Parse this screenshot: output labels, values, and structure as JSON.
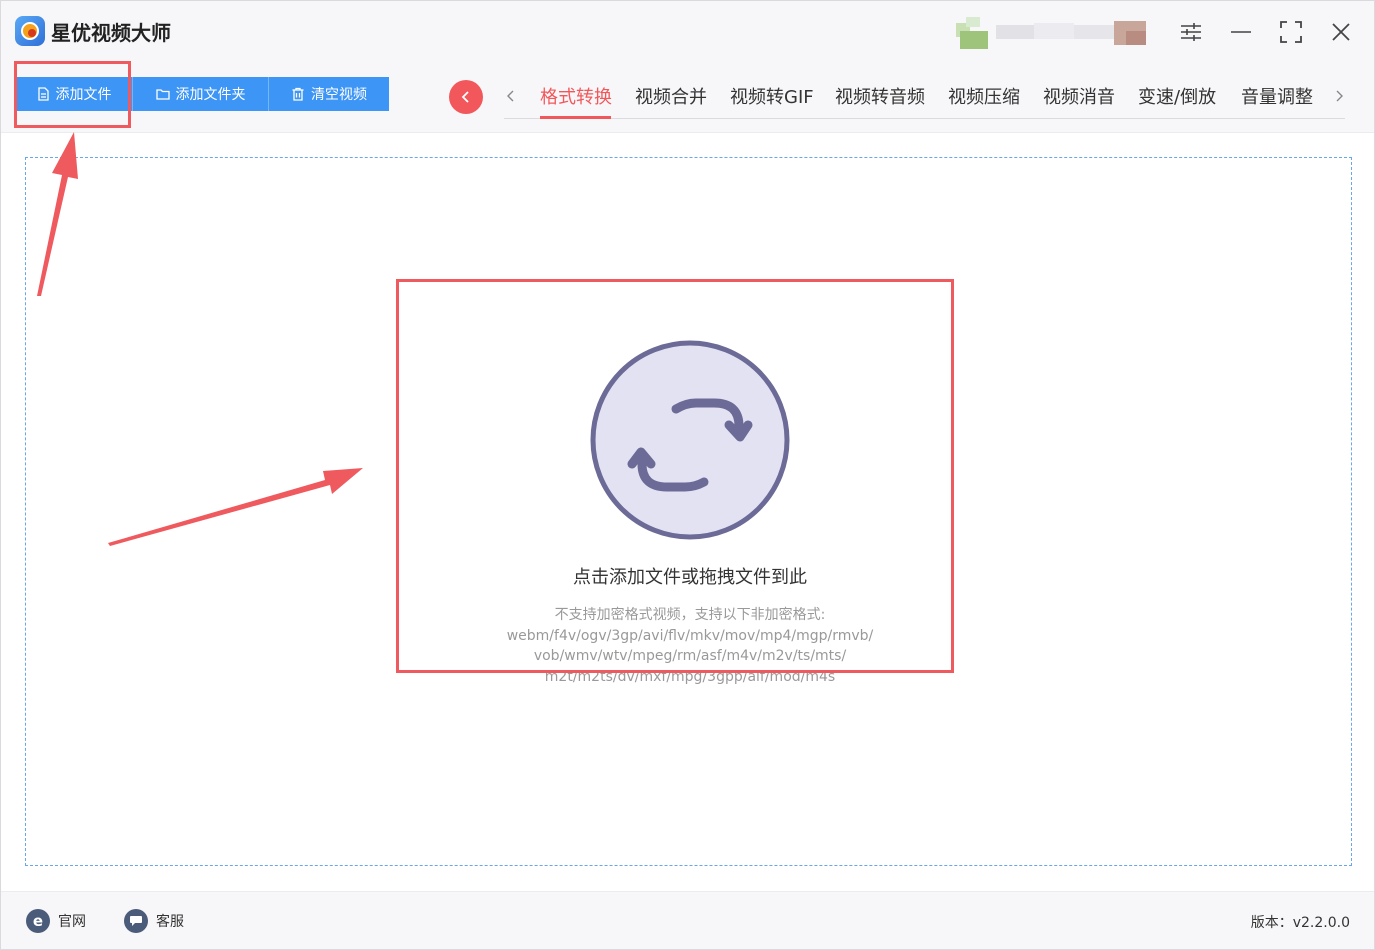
{
  "app": {
    "title": "星优视频大师"
  },
  "window_controls": [
    "settings-icon",
    "minimize-icon",
    "maximize-icon",
    "close-icon"
  ],
  "toolbar": {
    "buttons": [
      {
        "label": "添加文件",
        "icon": "file-icon"
      },
      {
        "label": "添加文件夹",
        "icon": "folder-icon"
      },
      {
        "label": "清空视频",
        "icon": "trash-icon"
      }
    ]
  },
  "tabs": {
    "items": [
      "格式转换",
      "视频合并",
      "视频转GIF",
      "视频转音频",
      "视频压缩",
      "视频消音",
      "变速/倒放",
      "音量调整"
    ],
    "active": "格式转换"
  },
  "dropzone": {
    "title": "点击添加文件或拖拽文件到此",
    "hint_lines": [
      "不支持加密格式视频，支持以下非加密格式:",
      "webm/f4v/ogv/3gp/avi/flv/mkv/mov/mp4/mgp/rmvb/",
      "vob/wmv/wtv/mpeg/rm/asf/m4v/m2v/ts/mts/",
      "m2t/m2ts/dv/mxf/mpg/3gpp/aif/mod/m4s"
    ]
  },
  "footer": {
    "website_label": "官网",
    "support_label": "客服",
    "version": "版本：v2.2.0.0"
  },
  "colors": {
    "accent": "#3d95f5",
    "active_tab": "#f2585b",
    "annotation": "#ef5a5f",
    "icon_circle_fill": "#e3e2f3",
    "icon_circle_stroke": "#6c6a96"
  }
}
